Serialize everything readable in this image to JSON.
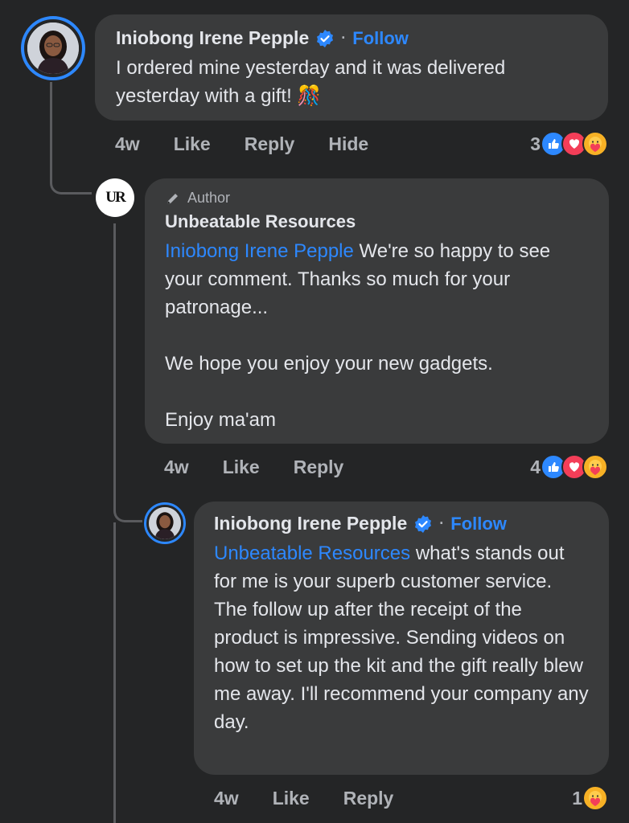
{
  "comments": [
    {
      "author": "Iniobong Irene Pepple",
      "follow": "Follow",
      "separator": "·",
      "text": "I ordered mine yesterday and it was delivered yesterday with a gift! 🎊",
      "time": "4w",
      "actions": [
        "Like",
        "Reply",
        "Hide"
      ],
      "reaction_count": "3",
      "reactions": [
        "like",
        "love",
        "care"
      ]
    },
    {
      "badge": "Author",
      "author": "Unbeatable Resources",
      "avatar_text": "UR",
      "mention": "Iniobong Irene Pepple",
      "text": " We're so happy to see your comment. Thanks so much for your patronage...",
      "para2": "We hope you enjoy your new gadgets.",
      "para3": "Enjoy ma'am",
      "time": "4w",
      "actions": [
        "Like",
        "Reply"
      ],
      "reaction_count": "4",
      "reactions": [
        "like",
        "love",
        "care"
      ]
    },
    {
      "author": "Iniobong Irene Pepple",
      "follow": "Follow",
      "separator": "·",
      "mention": "Unbeatable Resources",
      "text": " what's stands out for me is your superb customer service. The follow up after the receipt of the product is impressive. Sending videos on how to set up the kit and the gift really blew me away. I'll recommend your company any day.",
      "time": "4w",
      "actions": [
        "Like",
        "Reply"
      ],
      "reaction_count": "1",
      "reactions": [
        "care"
      ]
    }
  ],
  "colors": {
    "background": "#242526",
    "bubble": "#3a3b3c",
    "accent": "#2d88ff",
    "muted": "#b0b3b8"
  }
}
